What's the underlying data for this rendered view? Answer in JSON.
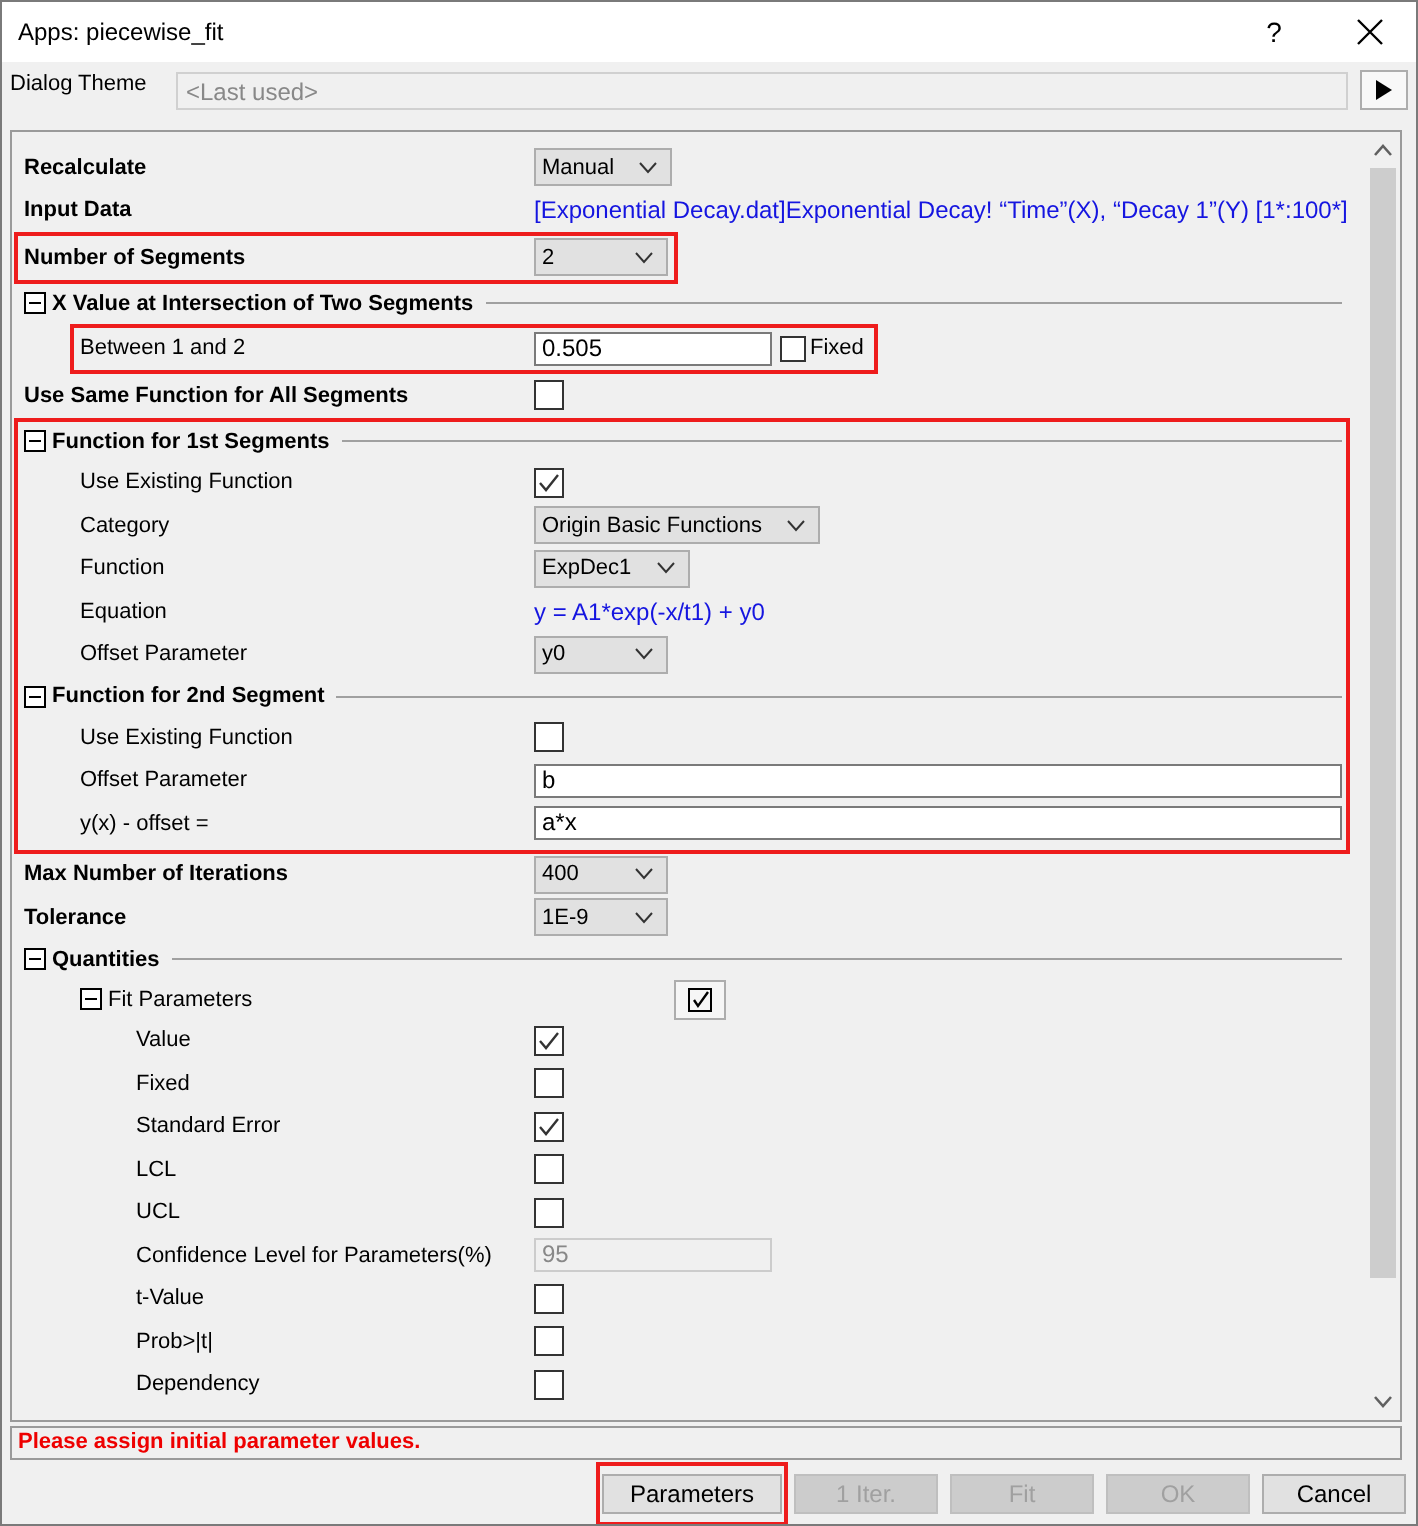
{
  "window": {
    "title": "Apps: piecewise_fit",
    "help": "?"
  },
  "theme": {
    "label": "Dialog Theme",
    "placeholder": "<Last used>"
  },
  "rows": [
    {
      "kind": "dropdown",
      "label": "Recalculate",
      "value": "Manual",
      "highlighted": false
    },
    {
      "kind": "text-value",
      "label": "Input Data",
      "value": "[Exponential Decay.dat]Exponential Decay! “Time”(X), “Decay 1”(Y) [1*:100*]",
      "highlighted": false
    },
    {
      "kind": "dropdown",
      "label": "Number of Segments",
      "value": "2",
      "highlighted": true
    },
    {
      "kind": "section",
      "label": "X Value at Intersection of Two Segments",
      "expanded": true,
      "children": [
        {
          "kind": "input",
          "label": "Between 1 and 2",
          "value": "0.505",
          "disabled": false,
          "fixed": {
            "label": "Fixed",
            "checked": false
          },
          "highlighted": true
        }
      ]
    },
    {
      "kind": "checkbox",
      "label": "Use Same Function for All Segments",
      "checked": false,
      "highlighted": false
    },
    {
      "kind": "group",
      "highlighted": true,
      "children": [
        {
          "kind": "section",
          "label": "Function for 1st Segments",
          "expanded": true,
          "children": [
            {
              "kind": "checkbox",
              "label": "Use Existing Function",
              "checked": true,
              "highlighted": false
            },
            {
              "kind": "dropdown",
              "label": "Category",
              "value": "Origin Basic Functions",
              "highlighted": false
            },
            {
              "kind": "dropdown",
              "label": "Function",
              "value": "ExpDec1",
              "highlighted": false
            },
            {
              "kind": "text-value",
              "label": "Equation",
              "value": "y = A1*exp(-x/t1) + y0",
              "highlighted": false
            },
            {
              "kind": "dropdown",
              "label": "Offset Parameter",
              "value": "y0",
              "highlighted": false
            }
          ]
        },
        {
          "kind": "section",
          "label": "Function for 2nd Segment",
          "expanded": true,
          "children": [
            {
              "kind": "checkbox",
              "label": "Use Existing Function",
              "checked": false,
              "highlighted": false
            },
            {
              "kind": "input",
              "label": "Offset Parameter",
              "value": "b",
              "disabled": false,
              "highlighted": false
            },
            {
              "kind": "input",
              "label": "y(x) - offset =",
              "value": "a*x",
              "disabled": false,
              "highlighted": false
            }
          ]
        }
      ]
    },
    {
      "kind": "dropdown",
      "label": "Max Number of Iterations",
      "value": "400",
      "highlighted": false
    },
    {
      "kind": "dropdown",
      "label": "Tolerance",
      "value": "1E-9",
      "highlighted": false
    },
    {
      "kind": "section",
      "label": "Quantities",
      "expanded": true,
      "children": [
        {
          "kind": "section",
          "label": "Fit Parameters",
          "expanded": true,
          "toggle": {
            "checked": true
          },
          "children": [
            {
              "kind": "checkbox",
              "label": "Value",
              "checked": true,
              "highlighted": false
            },
            {
              "kind": "checkbox",
              "label": "Fixed",
              "checked": false,
              "highlighted": false
            },
            {
              "kind": "checkbox",
              "label": "Standard Error",
              "checked": true,
              "highlighted": false
            },
            {
              "kind": "checkbox",
              "label": "LCL",
              "checked": false,
              "highlighted": false
            },
            {
              "kind": "checkbox",
              "label": "UCL",
              "checked": false,
              "highlighted": false
            },
            {
              "kind": "input",
              "label": "Confidence Level for Parameters(%)",
              "value": "95",
              "disabled": true,
              "highlighted": false
            },
            {
              "kind": "checkbox",
              "label": "t-Value",
              "checked": false,
              "highlighted": false
            },
            {
              "kind": "checkbox",
              "label": "Prob>|t|",
              "checked": false,
              "highlighted": false
            },
            {
              "kind": "checkbox",
              "label": "Dependency",
              "checked": false,
              "highlighted": false
            }
          ]
        }
      ]
    }
  ],
  "message": "Please assign initial parameter values.",
  "buttons": [
    {
      "label": "Parameters",
      "disabled": false,
      "highlighted": true
    },
    {
      "label": "1 Iter.",
      "disabled": true,
      "highlighted": false
    },
    {
      "label": "Fit",
      "disabled": true,
      "highlighted": false
    },
    {
      "label": "OK",
      "disabled": true,
      "highlighted": false
    },
    {
      "label": "Cancel",
      "disabled": false,
      "highlighted": false
    }
  ]
}
